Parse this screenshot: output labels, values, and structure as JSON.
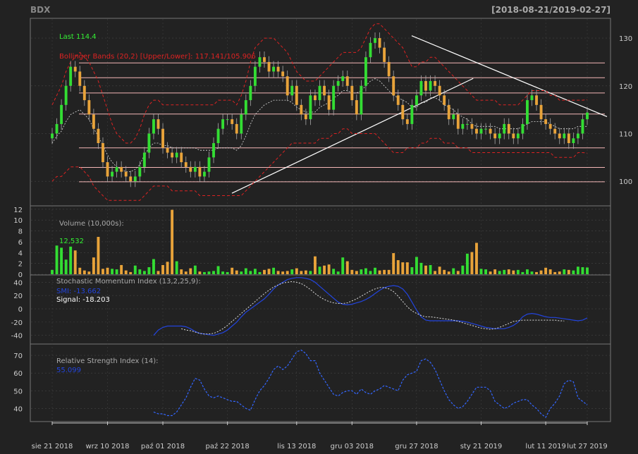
{
  "header": {
    "symbol": "BDX",
    "range": "[2018-08-21/2019-02-27]"
  },
  "colors": {
    "background": "#222222",
    "panel_border": "#888888",
    "grid": "#444444",
    "up_candle": "#33dd33",
    "down_candle": "#e8a33a",
    "bollinger": "#dd2222",
    "sma": "#dddddd",
    "smi": "#2244dd",
    "signal": "#dddddd",
    "rsi": "#3366ff",
    "hline": "#f4b6b6",
    "trendline": "#ffffff",
    "axis_text": "#cccccc"
  },
  "price_panel": {
    "last_label": "Last 114.4",
    "bbands_label": "Bollinger Bands (20,2) [Upper/Lower]: 117.141/105.906",
    "y_ticks": [
      "100",
      "110",
      "120",
      "130"
    ]
  },
  "volume_panel": {
    "title": "Volume (10,000s):",
    "last_value": "12,532",
    "y_ticks": [
      "0",
      "2",
      "4",
      "6",
      "8",
      "10",
      "12"
    ]
  },
  "smi_panel": {
    "title": "Stochastic Momentum Index (13,2,25,9):",
    "smi_label": "SMI: -13.662",
    "signal_label": "Signal: -18.203",
    "y_ticks": [
      "-40",
      "-20",
      "0",
      "20",
      "40"
    ]
  },
  "rsi_panel": {
    "title": "Relative Strength Index (14):",
    "value_label": "55.099",
    "y_ticks": [
      "40",
      "50",
      "60",
      "70"
    ]
  },
  "x_axis": {
    "labels": [
      "sie 21 2018",
      "wrz 10 2018",
      "paź 01 2018",
      "paź 22 2018",
      "lis 13 2018",
      "gru 03 2018",
      "gru 27 2018",
      "sty 21 2019",
      "lut 11 2019",
      "lut 27 2019"
    ]
  },
  "chart_data": {
    "type": "candlestick",
    "x_labels": [
      "sie 21 2018",
      "wrz 10 2018",
      "paź 01 2018",
      "paź 22 2018",
      "lis 13 2018",
      "gru 03 2018",
      "gru 27 2018",
      "sty 21 2019",
      "lut 11 2019",
      "lut 27 2019"
    ],
    "x_label_positions": [
      0,
      13,
      27,
      42,
      58,
      72,
      87,
      103,
      118,
      128
    ],
    "price": {
      "ylim": [
        95,
        134
      ],
      "close": [
        110,
        112,
        116,
        120,
        124,
        123,
        120,
        117,
        114,
        111,
        108,
        104,
        101,
        102,
        103,
        102,
        101,
        100,
        101,
        103,
        106,
        110,
        113,
        111,
        107,
        106,
        105,
        106,
        104,
        103,
        102,
        103,
        101,
        102,
        105,
        108,
        111,
        113,
        113,
        112,
        110,
        114,
        117,
        120,
        124,
        126,
        125,
        123,
        124,
        123,
        122,
        118,
        120,
        116,
        114,
        113,
        118,
        117,
        120,
        118,
        115,
        120,
        121,
        122,
        120,
        117,
        114,
        120,
        126,
        129,
        130,
        128,
        125,
        122,
        118,
        116,
        113,
        112,
        116,
        118,
        121,
        119,
        121,
        120,
        118,
        116,
        113,
        114,
        111,
        112,
        112,
        111,
        110,
        111,
        111,
        110,
        109,
        110,
        112,
        110,
        109,
        110,
        112,
        117,
        118,
        116,
        113,
        112,
        111,
        110,
        109,
        110,
        108,
        109,
        110,
        113,
        114.4
      ],
      "open": [
        109,
        110,
        112,
        116,
        120,
        124,
        123,
        120,
        117,
        114,
        111,
        108,
        104,
        101,
        102,
        103,
        102,
        101,
        100,
        101,
        103,
        106,
        110,
        113,
        111,
        107,
        106,
        105,
        106,
        104,
        103,
        102,
        103,
        101,
        102,
        105,
        108,
        111,
        113,
        113,
        112,
        110,
        114,
        117,
        120,
        124,
        126,
        125,
        123,
        124,
        123,
        122,
        118,
        120,
        116,
        114,
        113,
        118,
        117,
        120,
        118,
        115,
        120,
        121,
        122,
        120,
        117,
        114,
        120,
        126,
        129,
        130,
        128,
        125,
        122,
        118,
        116,
        113,
        112,
        116,
        118,
        121,
        119,
        121,
        120,
        118,
        116,
        113,
        114,
        111,
        112,
        112,
        111,
        110,
        111,
        111,
        110,
        109,
        110,
        112,
        110,
        109,
        110,
        112,
        117,
        118,
        116,
        113,
        112,
        111,
        110,
        109,
        110,
        108,
        109,
        110,
        113
      ],
      "bb_upper": [
        116,
        118,
        120,
        123,
        125,
        126,
        127,
        126,
        125,
        123,
        121,
        118,
        115,
        112,
        110,
        109,
        108,
        108,
        109,
        111,
        114,
        116,
        117,
        117,
        116,
        116,
        116,
        116,
        116,
        116,
        116,
        116,
        116,
        116,
        116,
        116,
        117,
        117,
        117,
        117,
        116,
        118,
        121,
        125,
        128,
        129,
        130,
        130,
        130,
        129,
        128,
        127,
        125,
        123,
        122,
        121,
        121,
        121,
        122,
        123,
        124,
        125,
        126,
        127,
        127,
        127,
        127,
        128,
        130,
        132,
        133,
        133,
        132,
        131,
        130,
        129,
        128,
        126,
        124,
        124,
        125,
        125,
        126,
        126,
        125,
        124,
        123,
        122,
        121,
        120,
        119,
        118,
        117,
        117,
        117,
        117,
        117,
        116,
        116,
        116,
        116,
        116,
        117,
        118,
        119,
        119,
        119,
        119,
        118,
        118,
        117,
        117,
        117,
        117,
        117,
        117,
        117.1
      ],
      "bb_lower": [
        100,
        101,
        101,
        102,
        103,
        103,
        103,
        102,
        101,
        99,
        98,
        97,
        96,
        96,
        96,
        96,
        96,
        96,
        96,
        96,
        97,
        98,
        99,
        99,
        99,
        99,
        98,
        98,
        98,
        98,
        98,
        98,
        97,
        97,
        97,
        97,
        97,
        97,
        97,
        97,
        97,
        97,
        98,
        99,
        100,
        101,
        102,
        103,
        104,
        105,
        106,
        107,
        108,
        108,
        108,
        108,
        108,
        108,
        109,
        109,
        109,
        110,
        110,
        111,
        111,
        110,
        110,
        110,
        110,
        110,
        110,
        109,
        108,
        107,
        106,
        106,
        106,
        107,
        107,
        107,
        108,
        108,
        109,
        109,
        109,
        108,
        108,
        108,
        107,
        107,
        107,
        106,
        106,
        106,
        106,
        106,
        106,
        106,
        106,
        106,
        106,
        106,
        106,
        106,
        106,
        106,
        106,
        106,
        106,
        105,
        105,
        105,
        105,
        105,
        106,
        106,
        105.9
      ],
      "horizontal_lines": [
        99.9,
        102.9,
        107.0,
        114.1,
        118.5,
        121.7,
        124.8
      ],
      "trendlines": [
        {
          "from": [
            43,
            97.5
          ],
          "to": [
            96,
            122
          ]
        },
        {
          "from": [
            86,
            130.5
          ],
          "to": [
            141,
            114
          ]
        }
      ]
    },
    "volume": {
      "ylim": [
        0,
        12.5
      ],
      "values": [
        0.8,
        5.3,
        4.9,
        2.7,
        5.1,
        4.4,
        1.2,
        0.7,
        0.5,
        3.1,
        6.9,
        1.0,
        1.2,
        1.0,
        0.9,
        1.7,
        0.7,
        0.4,
        1.6,
        0.9,
        0.6,
        1.3,
        2.8,
        0.6,
        1.7,
        2.3,
        11.9,
        2.4,
        0.9,
        0.5,
        1.1,
        1.6,
        0.5,
        0.4,
        0.5,
        0.6,
        1.5,
        0.5,
        0.4,
        1.2,
        0.7,
        0.5,
        1.1,
        0.6,
        1.0,
        0.4,
        0.8,
        1.0,
        1.2,
        0.6,
        0.5,
        0.6,
        0.9,
        1.1,
        0.6,
        0.7,
        0.6,
        3.3,
        1.4,
        1.6,
        1.8,
        1.0,
        0.5,
        3.1,
        2.4,
        0.8,
        0.6,
        0.9,
        1.1,
        0.6,
        1.2,
        0.7,
        0.8,
        0.8,
        3.9,
        2.6,
        2.2,
        2.2,
        1.3,
        3.2,
        2.1,
        1.6,
        1.7,
        0.6,
        1.4,
        0.8,
        0.5,
        1.1,
        0.6,
        1.6,
        3.8,
        4.1,
        5.8,
        1.0,
        0.9,
        0.5,
        0.9,
        0.6,
        0.8,
        0.9,
        0.7,
        0.8,
        0.4,
        0.9,
        0.5,
        0.4,
        0.7,
        1.2,
        0.9,
        0.4,
        0.5,
        0.9,
        0.8,
        0.7,
        1.4,
        1.3,
        1.25
      ],
      "colors_follow_candle": true
    },
    "smi": {
      "ylim": [
        -52,
        50
      ],
      "smi": [
        null,
        null,
        null,
        null,
        null,
        null,
        null,
        null,
        null,
        null,
        null,
        null,
        null,
        null,
        null,
        null,
        null,
        null,
        null,
        null,
        null,
        null,
        -40,
        -32,
        -28,
        -26,
        -26,
        -26,
        -26,
        -27,
        -30,
        -34,
        -37,
        -38,
        -39,
        -40,
        -38,
        -36,
        -32,
        -26,
        -20,
        -12,
        -5,
        0,
        5,
        10,
        15,
        22,
        30,
        36,
        40,
        44,
        46,
        47,
        47,
        46,
        44,
        40,
        34,
        28,
        22,
        16,
        10,
        7,
        6,
        7,
        9,
        11,
        14,
        18,
        23,
        28,
        32,
        34,
        35,
        34,
        30,
        22,
        10,
        -2,
        -12,
        -17,
        -18,
        -18,
        -18,
        -18,
        -18,
        -18,
        -18,
        -19,
        -20,
        -22,
        -24,
        -26,
        -28,
        -29,
        -30,
        -30,
        -30,
        -28,
        -25,
        -20,
        -12,
        -8,
        -7,
        -8,
        -10,
        -12,
        -13,
        -13,
        -14,
        -15,
        -16,
        -17,
        -18,
        -17,
        -13.662
      ],
      "signal": [
        null,
        null,
        null,
        null,
        null,
        null,
        null,
        null,
        null,
        null,
        null,
        null,
        null,
        null,
        null,
        null,
        null,
        null,
        null,
        null,
        null,
        null,
        null,
        null,
        null,
        null,
        null,
        null,
        -30,
        -32,
        -33,
        -35,
        -37,
        -38,
        -38,
        -37,
        -34,
        -30,
        -25,
        -19,
        -13,
        -7,
        -1,
        5,
        11,
        17,
        23,
        28,
        33,
        36,
        39,
        40,
        41,
        40,
        38,
        34,
        29,
        23,
        18,
        14,
        11,
        9,
        8,
        8,
        9,
        12,
        15,
        19,
        23,
        27,
        30,
        32,
        32,
        30,
        26,
        19,
        11,
        3,
        -3,
        -7,
        -10,
        -12,
        -12,
        -13,
        -14,
        -15,
        -16,
        -17,
        -19,
        -21,
        -23,
        -25,
        -27,
        -29,
        -30,
        -31,
        -30,
        -28,
        -25,
        -22,
        -19,
        -18,
        -17,
        -17,
        -17,
        -17,
        -17,
        -17,
        -17,
        -17,
        -18,
        -18.203
      ],
      "series": [
        {
          "name": "SMI"
        },
        {
          "name": "Signal"
        }
      ]
    },
    "rsi": {
      "ylim": [
        33,
        76
      ],
      "values": [
        null,
        null,
        null,
        null,
        null,
        null,
        null,
        null,
        null,
        null,
        null,
        null,
        null,
        null,
        null,
        null,
        null,
        null,
        null,
        null,
        null,
        null,
        38,
        37,
        37,
        36,
        36,
        38,
        42,
        46,
        52,
        57,
        56,
        51,
        47,
        46,
        47,
        46,
        45,
        44,
        44,
        42,
        40,
        39,
        45,
        50,
        53,
        57,
        62,
        64,
        62,
        64,
        68,
        72,
        73,
        71,
        67,
        67,
        60,
        56,
        52,
        48,
        47,
        49,
        50,
        50,
        48,
        51,
        49,
        48,
        50,
        51,
        53,
        52,
        51,
        50,
        56,
        59,
        60,
        61,
        67,
        68,
        66,
        62,
        56,
        50,
        45,
        42,
        40,
        41,
        44,
        48,
        52,
        52,
        52,
        50,
        44,
        42,
        40,
        41,
        43,
        44,
        45,
        45,
        42,
        40,
        37,
        35,
        40,
        43,
        47,
        54,
        56,
        55,
        46,
        44,
        42,
        43,
        42,
        44,
        47,
        44,
        42,
        41,
        43,
        45,
        47,
        49,
        48,
        55.099
      ],
      "series": [
        {
          "name": "RSI"
        }
      ]
    }
  }
}
